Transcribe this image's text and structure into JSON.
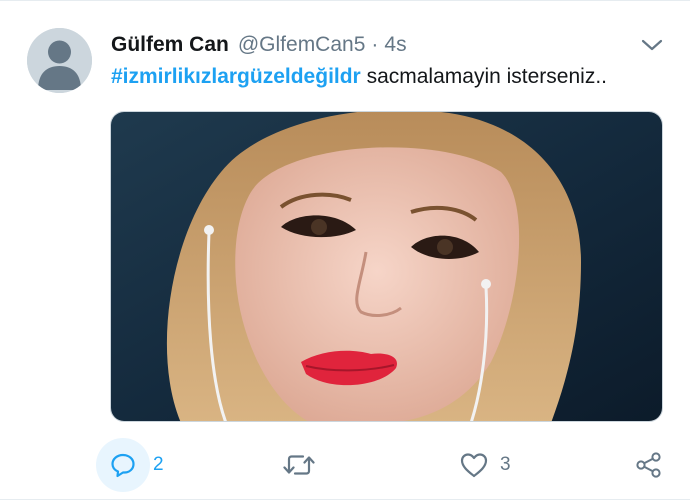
{
  "tweet": {
    "author_name": "Gülfem Can",
    "author_handle": "@GlfemCan5",
    "separator": "·",
    "timestamp": "4s",
    "hashtag": "#izmirlikızlargüzeldeğildr",
    "body": " sacmalamayin isterseniz..",
    "media_description": "selfie photo",
    "reply_count": "2",
    "like_count": "3"
  },
  "icons": {
    "avatar": "default-avatar-icon",
    "menu": "chevron-down-icon",
    "reply": "reply-icon",
    "retweet": "retweet-icon",
    "like": "heart-icon",
    "share": "share-icon"
  },
  "colors": {
    "accent": "#1da1f2",
    "secondary_text": "#657786",
    "primary_text": "#14171a",
    "reply_highlight": "#e8f5fe",
    "avatar_bg": "#ccd6dd"
  }
}
